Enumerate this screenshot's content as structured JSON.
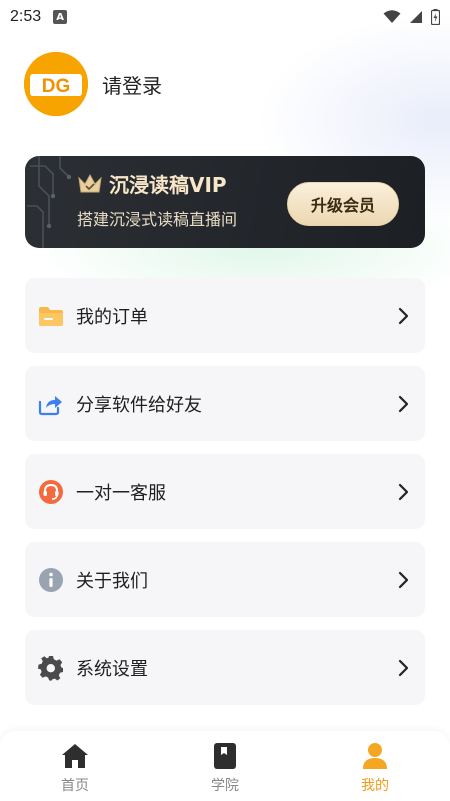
{
  "status_bar": {
    "time": "2:53",
    "notif_letter": "A"
  },
  "profile": {
    "avatar_text": "DG",
    "login_text": "请登录"
  },
  "vip": {
    "title": "沉浸读稿VIP",
    "subtitle": "搭建沉浸式读稿直播间",
    "button": "升级会员"
  },
  "menu": [
    {
      "label": "我的订单",
      "icon": "folder-icon"
    },
    {
      "label": "分享软件给好友",
      "icon": "share-icon"
    },
    {
      "label": "一对一客服",
      "icon": "support-icon"
    },
    {
      "label": "关于我们",
      "icon": "info-icon"
    },
    {
      "label": "系统设置",
      "icon": "gear-icon"
    }
  ],
  "tabs": [
    {
      "label": "首页",
      "icon": "home-icon",
      "active": false
    },
    {
      "label": "学院",
      "icon": "book-icon",
      "active": false
    },
    {
      "label": "我的",
      "icon": "user-icon",
      "active": true
    }
  ],
  "colors": {
    "accent": "#f39a1a",
    "vip_gold": "#f7e6c7",
    "card_bg": "#f6f6f8",
    "vip_bg": "#23272c"
  }
}
